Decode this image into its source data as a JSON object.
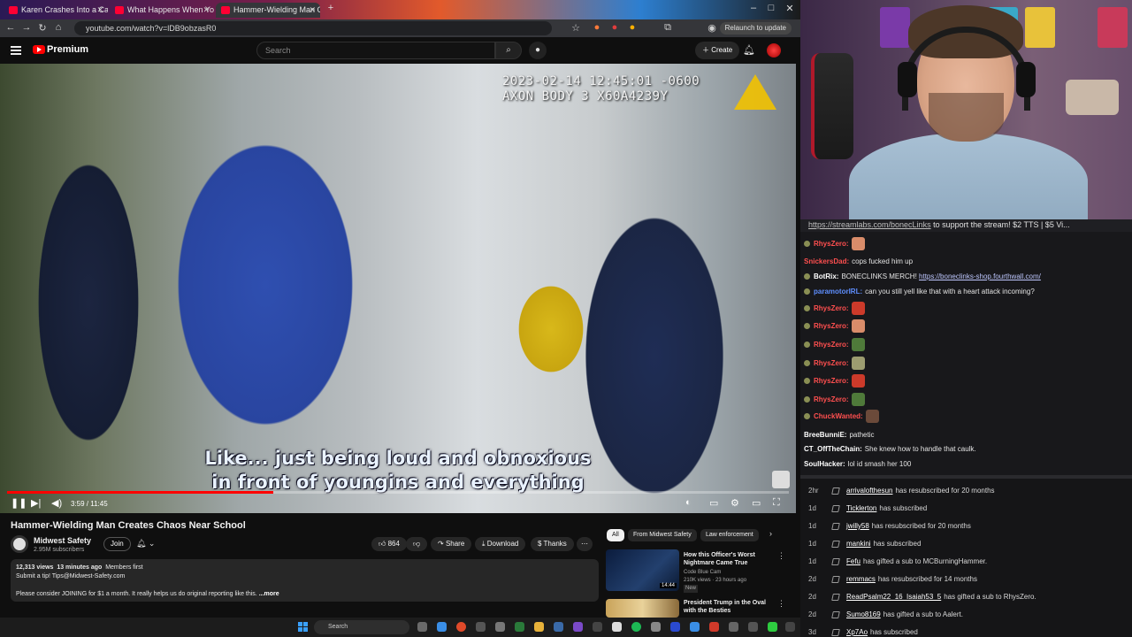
{
  "browser": {
    "tabs": [
      {
        "label": "Karen Crashes Into a Car While"
      },
      {
        "label": "What Happens When You Poin"
      },
      {
        "label": "Hammer-Wielding Man Cre"
      }
    ],
    "new_tab": "+",
    "url": "youtube.com/watch?v=lDB9obzasR0",
    "relaunch_label": "Relaunch to update"
  },
  "youtube": {
    "logo_text": "Premium",
    "search_placeholder": "Search",
    "create_label": "Create",
    "video": {
      "stamp_line1": "2023-02-14 12:45:01 -0600",
      "stamp_line2": "AXON BODY 3 X60A4239Y",
      "caption_line1": "Like... just being loud and obnoxious",
      "caption_line2": "in front of youngins and everything",
      "time": "3:59 / 11:45",
      "progress": 0.34
    },
    "title": "Hammer-Wielding Man Creates Chaos Near School",
    "channel": {
      "name": "Midwest Safety",
      "subs": "2.95M subscribers",
      "join": "Join"
    },
    "actions": {
      "likes": "864",
      "share": "Share",
      "download": "Download",
      "thanks": "Thanks"
    },
    "description": {
      "views": "12,313 views",
      "time": "13 minutes ago",
      "members": "Members first",
      "line1": "Submit a tip! Tips@Midwest-Safety.com",
      "line2": "Please consider JOINING for $1 a month. It really helps us do original reporting like this.",
      "more": "...more"
    },
    "chips": [
      {
        "label": "All"
      },
      {
        "label": "From Midwest Safety"
      },
      {
        "label": "Law enforcement"
      }
    ],
    "recommendations": [
      {
        "title": "How this Officer's Worst Nightmare Came True",
        "channel": "Code Blue Cam",
        "meta": "210K views · 23 hours ago",
        "badge": "New",
        "duration": "14:44"
      },
      {
        "title": "President Trump in the Oval with the Besties",
        "channel": "",
        "meta": "",
        "badge": "",
        "duration": ""
      }
    ]
  },
  "taskbar": {
    "search_label": "Search"
  },
  "chat": {
    "banner_link": "https://streamlabs.com/bonecLinks",
    "banner_text": " to support the stream! $2 TTS | $5 Vi...",
    "messages": [
      {
        "user": "RhysZero:",
        "text": "",
        "emote": "#d98c6a"
      },
      {
        "user": "SnickersDad:",
        "text": "cops fucked him up",
        "emote": ""
      },
      {
        "user": "BotRix:",
        "text": "BONECLINKS MERCH! ",
        "link": "https://boneclinks-shop.fourthwall.com/",
        "emote": ""
      },
      {
        "user": "paramotorIRL:",
        "text": "can you still yell like that with a heart attack incoming?",
        "emote": ""
      },
      {
        "user": "RhysZero:",
        "text": "",
        "emote": "#cc3a2a"
      },
      {
        "user": "RhysZero:",
        "text": "",
        "emote": "#d98c6a"
      },
      {
        "user": "RhysZero:",
        "text": "",
        "emote": "#4f7a3a"
      },
      {
        "user": "RhysZero:",
        "text": "",
        "emote": "#9c9c70"
      },
      {
        "user": "RhysZero:",
        "text": "",
        "emote": "#cc3a2a"
      },
      {
        "user": "RhysZero:",
        "text": "",
        "emote": "#4f7a3a"
      },
      {
        "user": "ChuckWanted:",
        "text": "",
        "emote": "#6b4a3a"
      },
      {
        "user": "BreeBunniE:",
        "text": "pathetic",
        "emote": ""
      },
      {
        "user": "CT_OffTheChain:",
        "text": "She knew how to handle that caulk.",
        "emote": ""
      },
      {
        "user": "SoulHacker:",
        "text": "lol id smash her 100",
        "emote": ""
      }
    ]
  },
  "feed": [
    {
      "age": "2hr",
      "user": "arrivalofthesun",
      "text": "has resubscribed for 20 months"
    },
    {
      "age": "1d",
      "user": "Ticklerton",
      "text": "has subscribed"
    },
    {
      "age": "1d",
      "user": "jwilly58",
      "text": "has resubscribed for 20 months"
    },
    {
      "age": "1d",
      "user": "mankini",
      "text": "has subscribed"
    },
    {
      "age": "1d",
      "user": "Fefu",
      "text": "has gifted a sub to MCBurningHammer."
    },
    {
      "age": "2d",
      "user": "remmacs",
      "text": "has resubscribed for 14 months"
    },
    {
      "age": "2d",
      "user": "ReadPsalm22_16_Isaiah53_5",
      "text": "has gifted a sub to RhysZero."
    },
    {
      "age": "2d",
      "user": "Sumo8169",
      "text": "has gifted a sub to Aalert."
    },
    {
      "age": "3d",
      "user": "Xp7Ao",
      "text": "has subscribed"
    }
  ]
}
